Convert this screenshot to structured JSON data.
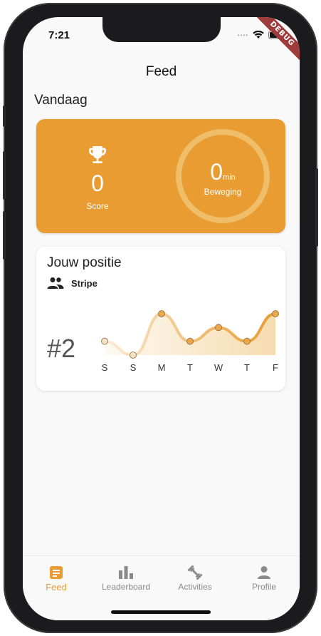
{
  "status_bar": {
    "time": "7:21",
    "debug_label": "DEBUG"
  },
  "app_bar": {
    "title": "Feed"
  },
  "today": {
    "heading": "Vandaag",
    "score": {
      "value": "0",
      "label": "Score",
      "icon": "trophy-icon"
    },
    "movement": {
      "value": "0",
      "unit": "min",
      "label": "Beweging"
    }
  },
  "position": {
    "title": "Jouw positie",
    "team_icon": "group-icon",
    "team_name": "Stripe",
    "rank": "#2"
  },
  "chart_data": {
    "type": "area",
    "categories": [
      "S",
      "S",
      "M",
      "T",
      "W",
      "T",
      "F"
    ],
    "values": [
      1,
      0,
      3,
      1,
      2,
      1,
      3
    ],
    "ylim": [
      0,
      3
    ],
    "colors": {
      "line": "#e89c31",
      "fill": "#f5d8a6"
    }
  },
  "nav": {
    "items": [
      {
        "label": "Feed",
        "icon": "feed-icon",
        "active": true
      },
      {
        "label": "Leaderboard",
        "icon": "leaderboard-icon",
        "active": false
      },
      {
        "label": "Activities",
        "icon": "activities-icon",
        "active": false
      },
      {
        "label": "Profile",
        "icon": "profile-icon",
        "active": false
      }
    ]
  },
  "colors": {
    "accent": "#e89c31",
    "background": "#f9f9f9",
    "inactive": "#8a8a8a"
  }
}
